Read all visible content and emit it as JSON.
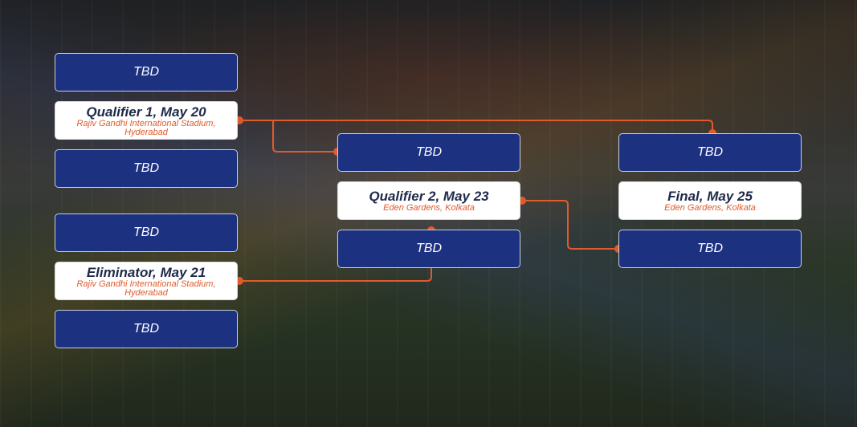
{
  "bracket": {
    "left": {
      "team_a": "TBD",
      "qualifier1": {
        "title": "Qualifier 1, May 20",
        "venue": "Rajiv Gandhi International Stadium, Hyderabad"
      },
      "team_b": "TBD",
      "team_c": "TBD",
      "eliminator": {
        "title": "Eliminator, May 21",
        "venue": "Rajiv Gandhi International Stadium, Hyderabad"
      },
      "team_d": "TBD"
    },
    "middle": {
      "team_a": "TBD",
      "qualifier2": {
        "title": "Qualifier 2, May 23",
        "venue": "Eden Gardens, Kolkata"
      },
      "team_b": "TBD"
    },
    "right": {
      "team_a": "TBD",
      "final": {
        "title": "Final, May 25",
        "venue": "Eden Gardens, Kolkata"
      },
      "team_b": "TBD"
    },
    "colors": {
      "team_box": "#1d3181",
      "connector": "#e05b2c",
      "match_title": "#1e2a4a",
      "venue_text": "#e05b2c"
    }
  }
}
